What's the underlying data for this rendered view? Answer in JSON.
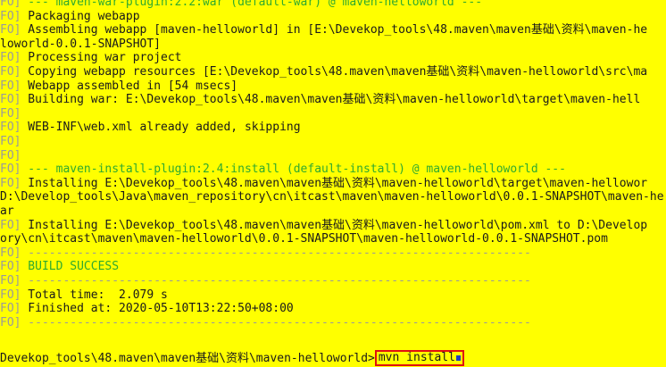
{
  "terminal": {
    "background": "#ffff00",
    "lines": [
      {
        "tag": "FO]",
        "text": " --- maven-war-plugin:2.2:war (default-war) @ maven-helloworld ---",
        "style": "plugin"
      },
      {
        "tag": "FO]",
        "text": " Packaging webapp",
        "style": "plain"
      },
      {
        "tag": "FO]",
        "text": " Assembling webapp [maven-helloworld] in [E:\\Devekop_tools\\48.maven\\maven基础\\资料\\maven-he",
        "style": "plain"
      },
      {
        "tag": "",
        "text": "loworld-0.0.1-SNAPSHOT]",
        "style": "plain"
      },
      {
        "tag": "FO]",
        "text": " Processing war project",
        "style": "plain"
      },
      {
        "tag": "FO]",
        "text": " Copying webapp resources [E:\\Devekop_tools\\48.maven\\maven基础\\资料\\maven-helloworld\\src\\ma",
        "style": "plain"
      },
      {
        "tag": "FO]",
        "text": " Webapp assembled in [54 msecs]",
        "style": "plain"
      },
      {
        "tag": "FO]",
        "text": " Building war: E:\\Devekop_tools\\48.maven\\maven基础\\资料\\maven-helloworld\\target\\maven-hell",
        "style": "plain"
      },
      {
        "tag": "FO]",
        "text": "",
        "style": "plain"
      },
      {
        "tag": "FO]",
        "text": " WEB-INF\\web.xml already added, skipping",
        "style": "plain"
      },
      {
        "tag": "FO]",
        "text": "",
        "style": "plain"
      },
      {
        "tag": "FO]",
        "text": "",
        "style": "plain"
      },
      {
        "tag": "FO]",
        "text": " --- maven-install-plugin:2.4:install (default-install) @ maven-helloworld ---",
        "style": "plugin"
      },
      {
        "tag": "FO]",
        "text": " Installing E:\\Devekop_tools\\48.maven\\maven基础\\资料\\maven-helloworld\\target\\maven-hellowor",
        "style": "plain"
      },
      {
        "tag": "",
        "text": "D:\\Develop_tools\\Java\\maven_repository\\cn\\itcast\\maven\\maven-helloworld\\0.0.1-SNAPSHOT\\maven-he",
        "style": "plain"
      },
      {
        "tag": "",
        "text": "ar",
        "style": "plain"
      },
      {
        "tag": "FO]",
        "text": " Installing E:\\Devekop_tools\\48.maven\\maven基础\\资料\\maven-helloworld\\pom.xml to D:\\Develop",
        "style": "plain"
      },
      {
        "tag": "",
        "text": "ory\\cn\\itcast\\maven\\maven-helloworld\\0.0.1-SNAPSHOT\\maven-helloworld-0.0.1-SNAPSHOT.pom",
        "style": "plain"
      },
      {
        "tag": "FO]",
        "text": " ------------------------------------------------------------------------",
        "style": "sep"
      },
      {
        "tag": "FO]",
        "text": " BUILD SUCCESS",
        "style": "success"
      },
      {
        "tag": "FO]",
        "text": " ------------------------------------------------------------------------",
        "style": "sep"
      },
      {
        "tag": "FO]",
        "text": " Total time:  2.079 s",
        "style": "plain"
      },
      {
        "tag": "FO]",
        "text": " Finished at: 2020-05-10T13:22:50+08:00",
        "style": "plain"
      },
      {
        "tag": "FO]",
        "text": " ------------------------------------------------------------------------",
        "style": "sep"
      }
    ],
    "prompt": {
      "path": "Devekop_tools\\48.maven\\maven基础\\资料\\maven-helloworld>",
      "command": "mvn install"
    }
  }
}
